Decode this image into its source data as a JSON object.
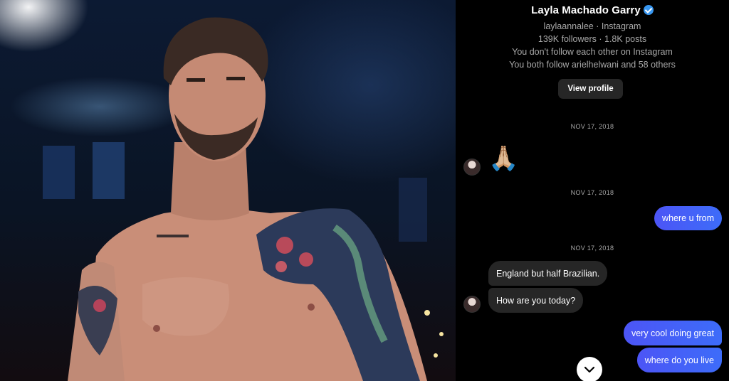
{
  "conversation": {
    "profile": {
      "name": "Layla Machado Garry",
      "verified": true,
      "handle_line": "laylaannalee · Instagram",
      "stats_line": "139K followers · 1.8K posts",
      "follow_status": "You don't follow each other on Instagram",
      "mutuals": "You both follow arielhelwani and 58 others",
      "view_profile_label": "View profile"
    },
    "date_separators": [
      "NOV 17, 2018",
      "NOV 17, 2018",
      "NOV 17, 2018"
    ],
    "messages": [
      {
        "from": "them",
        "text": "🙏🏼"
      },
      {
        "from": "me",
        "text": "where u from"
      },
      {
        "from": "them",
        "text": "England but half Brazilian."
      },
      {
        "from": "them",
        "text": "How are you today?"
      },
      {
        "from": "me",
        "text": "very cool doing great"
      },
      {
        "from": "me",
        "text": "where do you live"
      }
    ],
    "colors": {
      "background": "#000000",
      "incoming_bubble": "#262626",
      "outgoing_bubble": "#4c55f6",
      "verified_badge": "#3897f0"
    },
    "icons": {
      "verified": "verified-badge-icon",
      "scroll_down": "chevron-down-icon"
    }
  },
  "photo": {
    "subject": "shirtless tattooed fighter"
  }
}
